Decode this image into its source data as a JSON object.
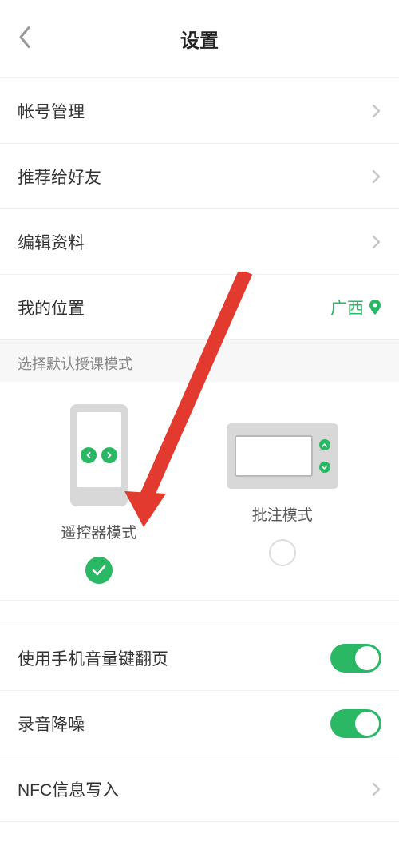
{
  "header": {
    "title": "设置"
  },
  "menu": {
    "account": "帐号管理",
    "recommend": "推荐给好友",
    "edit_profile": "编辑资料",
    "location_label": "我的位置",
    "location_value": "广西"
  },
  "mode_section": {
    "title": "选择默认授课模式",
    "options": {
      "remote": "遥控器模式",
      "annotate": "批注模式"
    }
  },
  "settings": {
    "volume_page": "使用手机音量键翻页",
    "noise_reduction": "录音降噪",
    "nfc_write": "NFC信息写入"
  }
}
